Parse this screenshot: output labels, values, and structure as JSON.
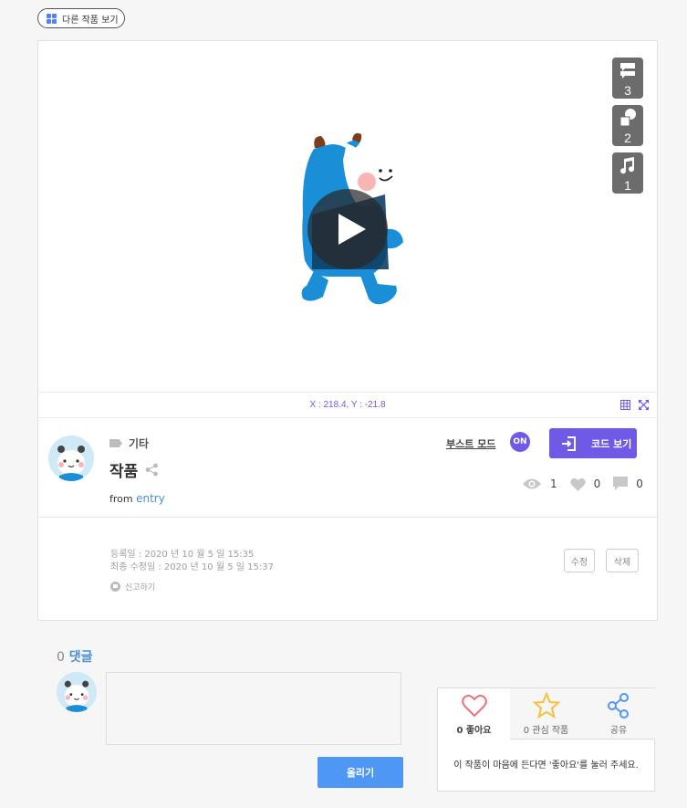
{
  "top": {
    "other_works_label": "다른 작품 보기"
  },
  "stage": {
    "side_buttons": [
      {
        "icon": "speech-bubbles-icon",
        "count": "3"
      },
      {
        "icon": "shapes-icon",
        "count": "2"
      },
      {
        "icon": "music-note-icon",
        "count": "1"
      }
    ],
    "coordinates": "X : 218.4,  Y : -21.8"
  },
  "project": {
    "category": "기타",
    "title": "작품",
    "from_label": "from",
    "from_link": "entry",
    "boost_mode_label": "부스트 모드",
    "boost_state": "ON",
    "code_view_label": "코드 보기",
    "views": "1",
    "likes": "0",
    "comments": "0",
    "registered": "등록일 : 2020 년 10 월 5 일 15:35",
    "modified": "최종 수정일 : 2020 년 10 월 5 일 15:37",
    "report_label": "신고하기",
    "edit_label": "수정",
    "delete_label": "삭제"
  },
  "comments": {
    "count": "0",
    "label": "댓글",
    "submit_label": "올리기",
    "placeholder": ""
  },
  "actions": {
    "like_label": "0 좋아요",
    "favorite_label": "0 관심 작품",
    "share_label": "공유",
    "message": "이 작품이 마음에 든다면 '좋아요'를 눌러 주세요."
  },
  "colors": {
    "accent_purple": "#6e5ae6",
    "link_blue": "#4a8fd8",
    "submit_blue": "#4f97f5"
  }
}
